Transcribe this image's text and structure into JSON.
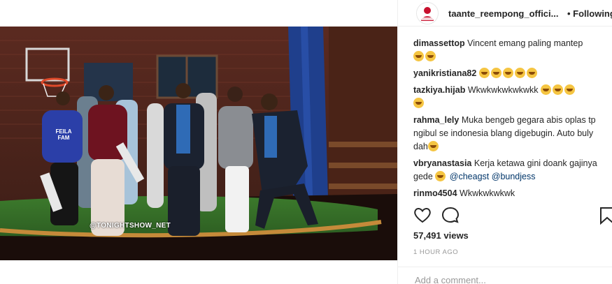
{
  "post": {
    "username": "taante_reempong_offici...",
    "follow_label": "• Following",
    "watermark": "@TONIGHTSHOW_NET",
    "shirt_text": "FEILA FAM"
  },
  "comments": [
    {
      "user": "dimassettop",
      "text": "Vincent emang paling mantep",
      "emojis": [
        "face-with-tears-of-joy",
        "face-with-tears-of-joy"
      ]
    },
    {
      "user": "yanikristiana82",
      "text": "",
      "emojis": [
        "face-with-tears-of-joy",
        "face-with-tears-of-joy",
        "face-with-tears-of-joy",
        "face-with-tears-of-joy",
        "face-with-tears-of-joy"
      ]
    },
    {
      "user": "tazkiya.hijab",
      "text": "Wkwkwkwkwkwkk",
      "emojis": [
        "face-with-tears-of-joy",
        "face-with-tears-of-joy",
        "face-with-tears-of-joy",
        "face-with-tears-of-joy"
      ]
    },
    {
      "user": "rahma_lely",
      "text": "Muka bengeb gegara abis oplas tp ngibul se indonesia blang digebugin. Auto buly dah",
      "emojis": [
        "face-with-tears-of-joy"
      ]
    },
    {
      "user": "vbryanastasia",
      "text": "Kerja ketawa gini doank gajinya gede",
      "emojis": [
        "rolling-on-floor-laughing"
      ],
      "mentions": [
        "@cheagst",
        "@bundjess"
      ]
    },
    {
      "user": "rinmo4504",
      "text": "Wkwkwkwkwk",
      "emojis": []
    }
  ],
  "actions": {
    "like_icon": "heart-icon",
    "comment_icon": "comment-bubble-icon",
    "save_icon": "bookmark-icon"
  },
  "likes": "57,491 views",
  "timestamp": "1 HOUR AGO",
  "add_comment_placeholder": "Add a comment..."
}
